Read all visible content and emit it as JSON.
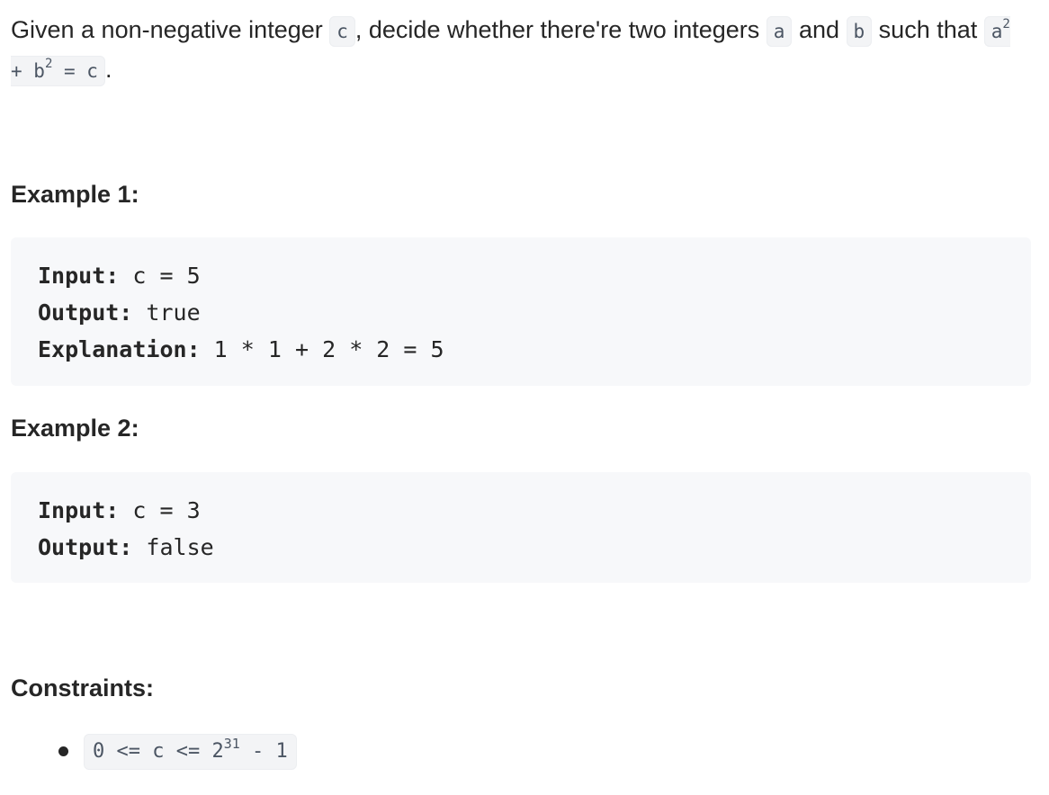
{
  "intro": {
    "part1": "Given a non-negative integer ",
    "code_c": "c",
    "part2": ", decide whether there're two integers ",
    "code_a": "a",
    "part3": " and ",
    "code_b": "b",
    "part4": " such that ",
    "eq_a": "a",
    "eq_a_exp": "2",
    "eq_plus": " + b",
    "eq_b_exp": "2",
    "eq_rest": " = c",
    "part5": "."
  },
  "example1": {
    "heading": "Example 1:",
    "input_key": "Input:",
    "input_val": " c = 5",
    "output_key": "Output:",
    "output_val": " true",
    "explanation_key": "Explanation:",
    "explanation_val": " 1 * 1 + 2 * 2 = 5"
  },
  "example2": {
    "heading": "Example 2:",
    "input_key": "Input:",
    "input_val": " c = 3",
    "output_key": "Output:",
    "output_val": " false"
  },
  "constraints": {
    "heading": "Constraints:",
    "item_prefix": "0 <= c <= 2",
    "item_exp": "31",
    "item_suffix": " - 1"
  }
}
